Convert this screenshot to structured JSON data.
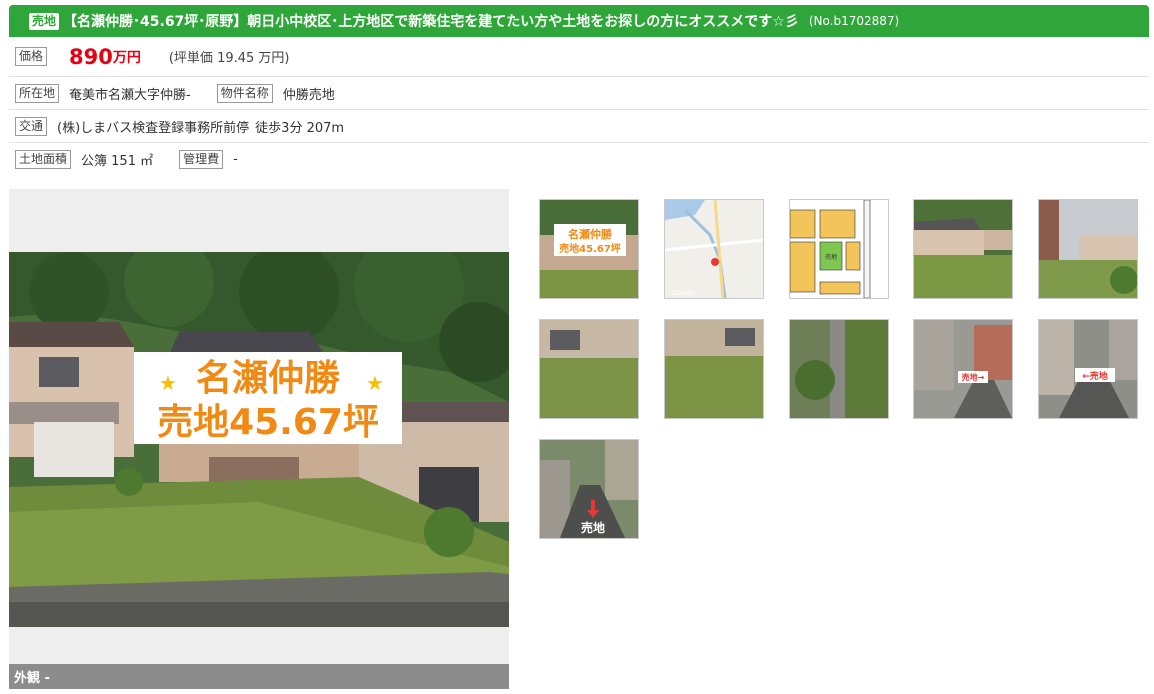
{
  "header": {
    "badge": "売地",
    "title": "【名瀬仲勝･45.67坪･原野】朝日小中校区･上方地区で新築住宅を建てたい方や土地をお探しの方にオススメです☆彡",
    "property_no": "(No.b1702887)"
  },
  "price": {
    "label": "価格",
    "amount": "890",
    "unit": "万円",
    "per_tsubo": "(坪単価 19.45 万円)"
  },
  "location": {
    "label": "所在地",
    "value": "奄美市名瀬大字仲勝-",
    "name_label": "物件名称",
    "name_value": "仲勝売地"
  },
  "transport": {
    "label": "交通",
    "value": "(株)しまバス検査登録事務所前停",
    "walk": "徒歩3分 207m"
  },
  "land": {
    "label": "土地面積",
    "value": "公簿 151 ㎡",
    "fee_label": "管理費",
    "fee_value": "-"
  },
  "main_photo": {
    "sign_line1": "名瀬仲勝",
    "sign_line2": "売地45.67坪",
    "caption": "外観 -"
  },
  "thumbnails": [
    {
      "kind": "sign-photo",
      "line1": "名瀬仲勝",
      "line2": "売地45.67坪"
    },
    {
      "kind": "map",
      "text": "Google"
    },
    {
      "kind": "plot-map",
      "text": "売地"
    },
    {
      "kind": "photo"
    },
    {
      "kind": "photo"
    },
    {
      "kind": "photo"
    },
    {
      "kind": "photo"
    },
    {
      "kind": "photo"
    },
    {
      "kind": "photo-label",
      "text": "売地→"
    },
    {
      "kind": "photo-label",
      "text": "←売地"
    },
    {
      "kind": "photo-arrow",
      "text": "売地"
    }
  ],
  "colors": {
    "header_green": "#2ea63a",
    "price_red": "#e60012",
    "sign_orange": "#f08a14"
  }
}
